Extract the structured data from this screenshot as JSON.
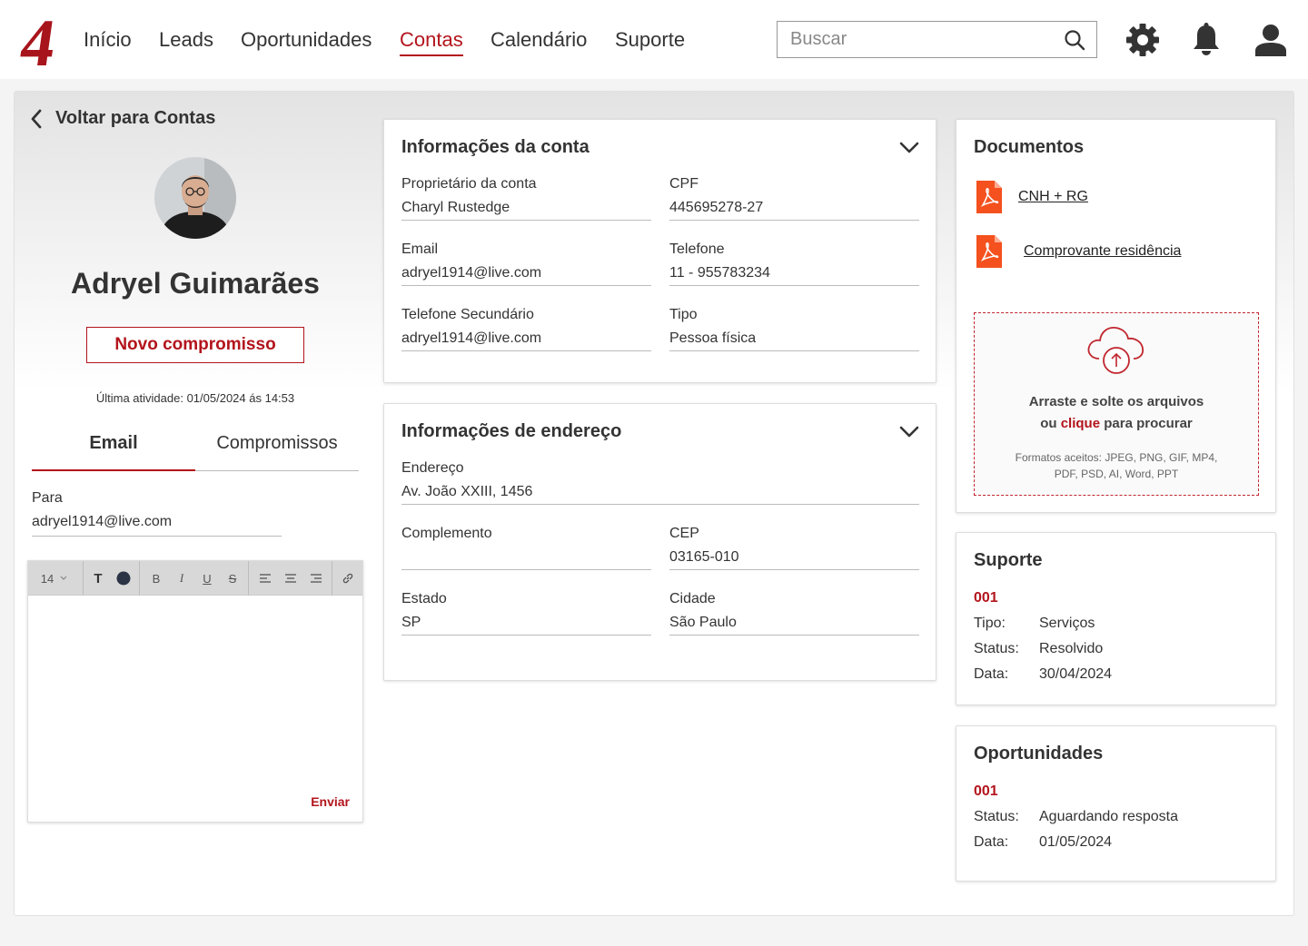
{
  "nav": {
    "links": [
      "Início",
      "Leads",
      "Oportunidades",
      "Contas",
      "Calendário",
      "Suporte"
    ],
    "active": "Contas",
    "search_placeholder": "Buscar",
    "logo_text": "4"
  },
  "colors": {
    "accent": "#b3141c",
    "pdf": "#f4511e"
  },
  "profile": {
    "back_label": "Voltar para Contas",
    "name": "Adryel Guimarães",
    "new_button": "Novo compromisso",
    "last_activity": "Última atividade: 01/05/2024 ás 14:53",
    "tabs": [
      "Email",
      "Compromissos"
    ],
    "to_label": "Para",
    "to_value": "adryel1914@live.com"
  },
  "editor": {
    "font_size": "14",
    "text_color_label": "T",
    "bold": "B",
    "italic": "I",
    "underline": "U",
    "strike": "S",
    "send_label": "Enviar"
  },
  "account_info": {
    "title": "Informações da conta",
    "fields": [
      {
        "label": "Proprietário da conta",
        "value": "Charyl Rustedge"
      },
      {
        "label": "CPF",
        "value": "445695278-27"
      },
      {
        "label": "Email",
        "value": "adryel1914@live.com"
      },
      {
        "label": "Telefone",
        "value": "11 - 955783234"
      },
      {
        "label": "Telefone Secundário",
        "value": "adryel1914@live.com"
      },
      {
        "label": "Tipo",
        "value": "Pessoa física"
      }
    ]
  },
  "address_info": {
    "title": "Informações de endereço",
    "fields": [
      {
        "label": "Endereço",
        "value": "Av. João XXIII, 1456"
      },
      {
        "label": "Complemento",
        "value": ""
      },
      {
        "label": "CEP",
        "value": "03165-010"
      },
      {
        "label": "Estado",
        "value": "SP"
      },
      {
        "label": "Cidade",
        "value": "São Paulo"
      }
    ]
  },
  "documents": {
    "title": "Documentos",
    "files": [
      "CNH + RG",
      "Comprovante residência"
    ],
    "drop_line1": "Arraste e solte os arquivos",
    "drop_line2_pre": "ou ",
    "drop_line2_link": "clique",
    "drop_line2_post": " para procurar",
    "formats": "Formatos aceitos: JPEG, PNG, GIF, MP4, PDF, PSD, AI, Word, PPT"
  },
  "support": {
    "title": "Suporte",
    "code": "001",
    "rows": [
      {
        "k": "Tipo:",
        "v": "Serviços"
      },
      {
        "k": "Status:",
        "v": "Resolvido"
      },
      {
        "k": "Data:",
        "v": "30/04/2024"
      }
    ]
  },
  "opportunities": {
    "title": "Oportunidades",
    "code": "001",
    "rows": [
      {
        "k": "Status:",
        "v": "Aguardando resposta"
      },
      {
        "k": "Data:",
        "v": "01/05/2024"
      }
    ]
  }
}
